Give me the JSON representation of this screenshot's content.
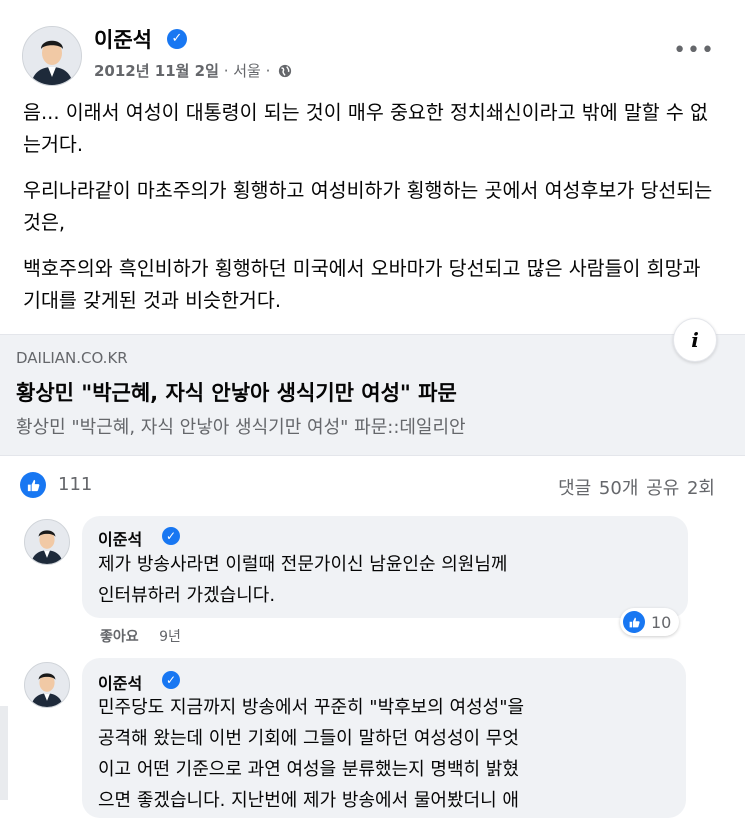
{
  "post": {
    "author": "이준석",
    "date": "2012년 11월 2일",
    "location": "서울",
    "separator": "·",
    "more_icon": "ellipsis-icon",
    "paragraphs": [
      "음... 이래서 여성이 대통령이 되는 것이 매우 중요한 정치쇄신이라고 밖에 말할 수 없는거다.",
      "우리나라같이 마초주의가 횡행하고 여성비하가 횡행하는 곳에서 여성후보가 당선되는 것은,",
      "백호주의와 흑인비하가 횡행하던 미국에서 오바마가 당선되고 많은 사람들이 희망과 기대를 갖게된 것과 비슷한거다."
    ]
  },
  "link": {
    "domain": "DAILIAN.CO.KR",
    "title": "황상민 \"박근혜, 자식 안낳아 생식기만 여성\" 파문",
    "subtitle": "황상민 \"박근혜, 자식 안낳아 생식기만 여성\" 파문::데일리안"
  },
  "stats": {
    "likes": "111",
    "comments": "댓글 50개",
    "shares": "공유 2회"
  },
  "comments": [
    {
      "author": "이준석",
      "text": "제가 방송사라면 이럴때 전문가이신 남윤인순 의원님께\n인터뷰하러 가겠습니다.",
      "like_label": "좋아요",
      "age": "9년",
      "reactions": "10"
    },
    {
      "author": "이준석",
      "text": "민주당도 지금까지 방송에서 꾸준히 \"박후보의 여성성\"을\n공격해 왔는데 이번 기회에 그들이 말하던 여성성이 무엇\n이고 어떤 기준으로 과연 여성을 분류했는지 명백히 밝혔\n으면 좋겠습니다. 지난번에 제가 방송에서 물어봤더니 애"
    }
  ],
  "colors": {
    "accent": "#1877f2",
    "muted_text": "#65676b",
    "bubble_bg": "#f0f2f5"
  }
}
